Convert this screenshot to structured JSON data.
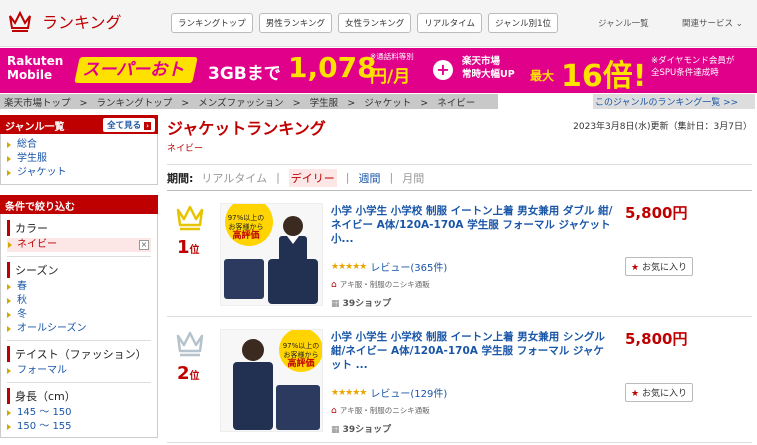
{
  "header": {
    "logo_text": "ランキング",
    "nav": [
      "ランキングトップ",
      "男性ランキング",
      "女性ランキング",
      "リアルタイム",
      "ジャンル別1位"
    ],
    "genre_list": "ジャンル一覧",
    "related": "関連サービス"
  },
  "banner": {
    "brand_line1": "Rakuten",
    "brand_line2": "Mobile",
    "super": "スーパーおトク",
    "gb": "3GBまで",
    "price": "1,078",
    "yen": "円/月",
    "note": "※通話料等別",
    "plus": "+",
    "ichiba1": "楽天市場",
    "ichiba2": "常時大幅UP",
    "max": "最大",
    "multiplier": "16倍!",
    "dia1": "※ダイヤモンド会員が",
    "dia2": "全SPU条件達成時"
  },
  "breadcrumb": {
    "items": [
      "楽天市場トップ",
      "ランキングトップ",
      "メンズファッション",
      "学生服",
      "ジャケット",
      "ネイビー"
    ],
    "sep": ">",
    "right_link": "このジャンルのランキング一覧 >>"
  },
  "sidebar": {
    "genre_title": "ジャンル一覧",
    "show_all": "全て見る",
    "genres": [
      "総合",
      "学生服",
      "ジャケット"
    ],
    "filter_title": "条件で絞り込む",
    "color_label": "カラー",
    "color_selected": "ネイビー",
    "remove": "×",
    "season_label": "シーズン",
    "seasons": [
      "春",
      "秋",
      "冬",
      "オールシーズン"
    ],
    "taste_label": "テイスト（ファッション）",
    "tastes": [
      "フォーマル"
    ],
    "height_label": "身長（cm）",
    "heights": [
      "145 ～ 150",
      "150 ～ 155"
    ]
  },
  "main": {
    "title": "ジャケットランキング",
    "subtitle": "ネイビー",
    "updated": "2023年3月8日(水)更新（集計日：3月7日）",
    "period_label": "期間:",
    "periods": [
      "リアルタイム",
      "デイリー",
      "週間",
      "月間"
    ],
    "period_sep": "|"
  },
  "items": [
    {
      "rank": "1",
      "rank_suffix": "位",
      "name": "小学 小学生 小学校 制服 イートン上着 男女兼用 ダブル 紺/ネイビー A体/120A-170A 学生服 フォーマル ジャケット 小...",
      "stars": "★★★★★",
      "reviews": "レビュー(365件)",
      "shop": "アキ服・制服のニシキ通販",
      "shop_count": "39ショップ",
      "price": "5,800円",
      "fav": "お気に入り",
      "badge1": "97%以上の",
      "badge2": "お客様から",
      "badge3": "高評価"
    },
    {
      "rank": "2",
      "rank_suffix": "位",
      "name": "小学 小学生 小学校 制服 イートン上着 男女兼用 シングル 紺/ネイビー A体/120A-170A 学生服 フォーマル ジャケット ...",
      "stars": "★★★★★",
      "reviews": "レビュー(129件)",
      "shop": "アキ服・制服のニシキ通販",
      "shop_count": "39ショップ",
      "price": "5,800円",
      "fav": "お気に入り",
      "badge1": "97%以上の",
      "badge2": "お客様から",
      "badge3": "高評価"
    }
  ],
  "colors": {
    "brand_red": "#bf0000",
    "banner_pink": "#e0008a",
    "banner_yellow": "#ffe100",
    "link_blue": "#1a56a7",
    "crown_gold": "#e8c400",
    "crown_silver": "#b7c3cc"
  }
}
